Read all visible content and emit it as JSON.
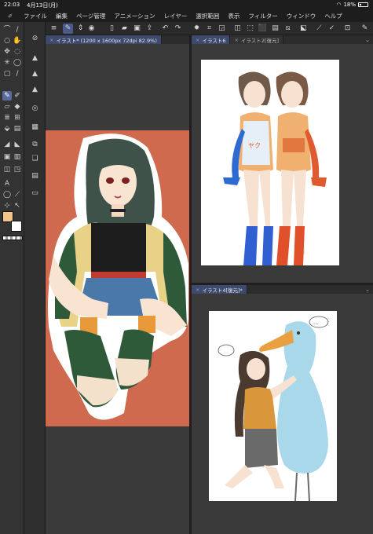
{
  "statusbar": {
    "time": "22:03",
    "date": "4月13日(月)",
    "battery": "18%"
  },
  "menu": [
    "ファイル",
    "編集",
    "ページ管理",
    "アニメーション",
    "レイヤー",
    "選択範囲",
    "表示",
    "フィルター",
    "ウィンドウ",
    "ヘルプ"
  ],
  "panes": {
    "left": {
      "tab_label": "イラスト* (1200 x 1600px 72dpi 82.9%)"
    },
    "right_top": {
      "tab1_label": "イラスト6",
      "tab2_label": "イラスト2[復元]"
    },
    "right_bottom": {
      "tab_label": "イラスト4[復元]*"
    }
  },
  "bubble_text": "...",
  "colors": {
    "main": "#f2c48a",
    "sub": "#ffffff",
    "accent": "#4b5a8a",
    "left_canvas_bg": "#cf6a4e"
  },
  "icons": {
    "tools": [
      "brush-icon",
      "eyedropper-icon",
      "magnifier-icon",
      "hand-icon",
      "move-icon",
      "rotate-icon",
      "wand-icon",
      "lasso-icon",
      "selection-icon",
      "pen-icon",
      "pencil-icon",
      "marker-icon",
      "eraser-icon",
      "blend-icon",
      "frame-icon",
      "layer-icon",
      "bucket-icon",
      "gradient-icon",
      "figure-icon",
      "ruler-icon",
      "text-icon",
      "balloon-icon",
      "line-icon",
      "correct-icon"
    ],
    "subtools": [
      "navigator-icon",
      "layer-property-icon",
      "tone-icon",
      "fill-icon",
      "color-circle-icon",
      "color-set-icon",
      "layers-icon",
      "material-icon",
      "history-icon",
      "sub-view-icon"
    ],
    "commands": [
      "menu-icon",
      "pen-pressure-icon",
      "stepper-icon",
      "record-icon",
      "new-file-icon",
      "open-icon",
      "save-icon",
      "export-icon",
      "undo-icon",
      "redo-icon",
      "clear-icon",
      "deselect-icon",
      "invert-selection-icon",
      "select-all-icon",
      "transform-icon",
      "crop-icon",
      "fill-selection-icon",
      "clip-icon",
      "lock-icon",
      "filter-icon",
      "rotate-view-icon"
    ]
  }
}
